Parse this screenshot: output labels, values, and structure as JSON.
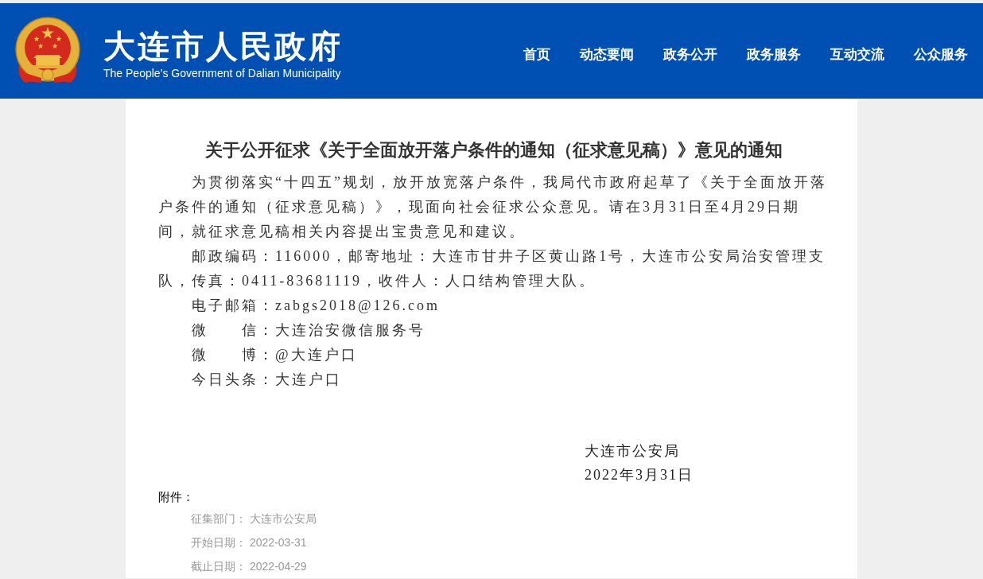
{
  "header": {
    "site_title": "大连市人民政府",
    "site_subtitle": "The People’s Government of Dalian Municipality",
    "nav": [
      "首页",
      "动态要闻",
      "政务公开",
      "政务服务",
      "互动交流",
      "公众服务"
    ]
  },
  "article": {
    "title": "关于公开征求《关于全面放开落户条件的通知（征求意见稿）》意见的通知",
    "paragraphs": [
      "为贯彻落实“十四五”规划，放开放宽落户条件，我局代市政府起草了《关于全面放开落户条件的通知（征求意见稿）》，现面向社会征求公众意见。请在3月31日至4月29日期间，就征求意见稿相关内容提出宝贵意见和建议。",
      "邮政编码：116000，邮寄地址：大连市甘井子区黄山路1号，大连市公安局治安管理支队，传真：0411-83681119，收件人：人口结构管理大队。",
      "电子邮箱：zabgs2018@126.com",
      "微　　信：大连治安微信服务号",
      "微　　博：@大连户口",
      "今日头条：大连户口"
    ],
    "signature": {
      "organization": "大连市公安局",
      "date": "2022年3月31日"
    },
    "attachments_label": "附件：",
    "meta": [
      {
        "label": "征集部门：",
        "value": "大连市公安局"
      },
      {
        "label": "开始日期：",
        "value": "2022-03-31"
      },
      {
        "label": "截止日期：",
        "value": "2022-04-29"
      }
    ]
  }
}
